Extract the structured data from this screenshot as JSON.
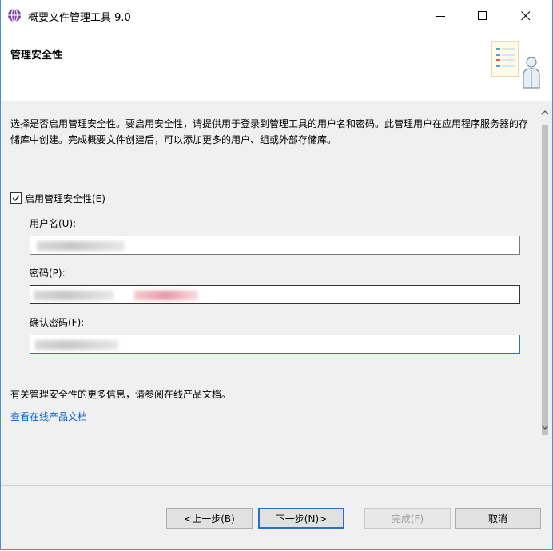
{
  "window": {
    "title": "概要文件管理工具 9.0",
    "controls": {
      "minimize": "minimize",
      "maximize": "maximize",
      "close": "close"
    }
  },
  "header": {
    "title": "管理安全性"
  },
  "content": {
    "description": "选择是否启用管理安全性。要启用安全性，请提供用于登录到管理工具的用户名和密码。此管理用户在应用程序服务器的存储库中创建。完成概要文件创建后，可以添加更多的用户、组或外部存储库。",
    "enable_checkbox": {
      "label": "启用管理安全性(E)",
      "checked": true
    },
    "username": {
      "label": "用户名(U):",
      "value": ""
    },
    "password": {
      "label": "密码(P):",
      "value": ""
    },
    "confirm_password": {
      "label": "确认密码(F):",
      "value": ""
    },
    "info_text": "有关管理安全性的更多信息，请参阅在线产品文档。",
    "link_text": "查看在线产品文档"
  },
  "buttons": {
    "back": "<上一步(B)",
    "next": "下一步(N)>",
    "finish": "完成(F)",
    "cancel": "取消"
  },
  "colors": {
    "accent": "#2a6fc9",
    "link": "#0b62c7",
    "content_bg": "#f0f0f0"
  }
}
